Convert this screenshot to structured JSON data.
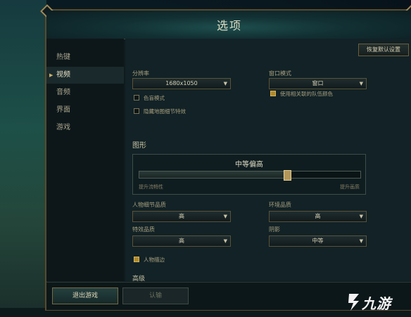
{
  "dialog": {
    "title": "选项"
  },
  "sidebar": {
    "items": [
      {
        "label": "热键"
      },
      {
        "label": "视频"
      },
      {
        "label": "音频"
      },
      {
        "label": "界面"
      },
      {
        "label": "游戏"
      }
    ],
    "active_index": 1
  },
  "toolbar": {
    "reset_label": "恢复默认设置"
  },
  "video": {
    "resolution_label": "分辨率",
    "resolution_value": "1680x1050",
    "window_mode_label": "窗口模式",
    "window_mode_value": "窗口",
    "colorblind_label": "色盲模式",
    "colorblind_checked": false,
    "hide_eyecandy_label": "隐藏地图细节特效",
    "hide_eyecandy_checked": false,
    "team_color_label": "使用相关联的队伍颜色",
    "team_color_checked": true
  },
  "graphics": {
    "section_label": "图形",
    "level_label": "中等偏高",
    "slider_value": 0.67,
    "hint_left": "提升流畅性",
    "hint_right": "提升画质",
    "character_quality_label": "人物细节品质",
    "character_quality_value": "高",
    "environment_quality_label": "环境品质",
    "environment_quality_value": "高",
    "effects_quality_label": "特效品质",
    "effects_quality_value": "高",
    "shadows_label": "阴影",
    "shadows_value": "中等",
    "character_inking_label": "人物描边",
    "character_inking_checked": true,
    "advanced_label": "高级"
  },
  "footer": {
    "exit_label": "退出游戏",
    "confirm_label": "认输"
  },
  "watermark": {
    "text": "九游"
  },
  "colors": {
    "accent_gold": "#b08a2a",
    "panel_bg": "#122226"
  }
}
